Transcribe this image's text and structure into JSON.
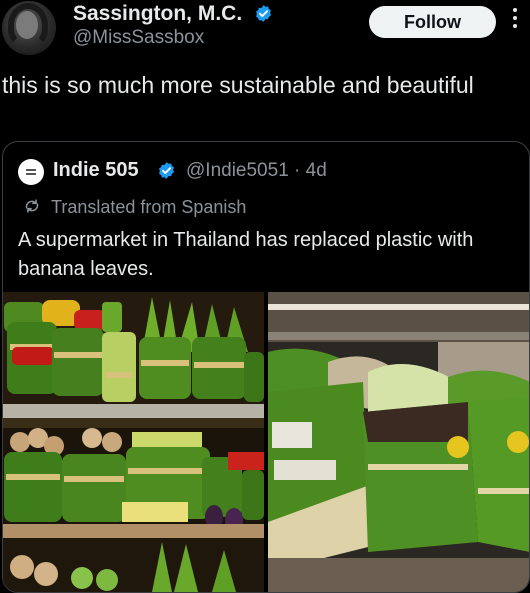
{
  "author": {
    "display_name": "Sassington, M.C.",
    "handle": "@MissSassbox",
    "follow_label": "Follow"
  },
  "tweet": {
    "text": "this is so much more sustainable and beautiful"
  },
  "quote": {
    "name": "Indie 505",
    "meta": "@Indie5051 · 4d",
    "translated_label": "Translated from Spanish",
    "text": "A supermarket in Thailand has replaced plastic with banana leaves."
  },
  "icons": {
    "verified": "verified-badge-icon",
    "more": "more-vertical-icon",
    "translate": "translate-icon"
  },
  "colors": {
    "background": "#000000",
    "text": "#e7e9ea",
    "secondary": "#8b9298",
    "verified_blue": "#1d9bf0",
    "follow_bg": "#eff3f4",
    "card_border": "#3a3f43"
  }
}
